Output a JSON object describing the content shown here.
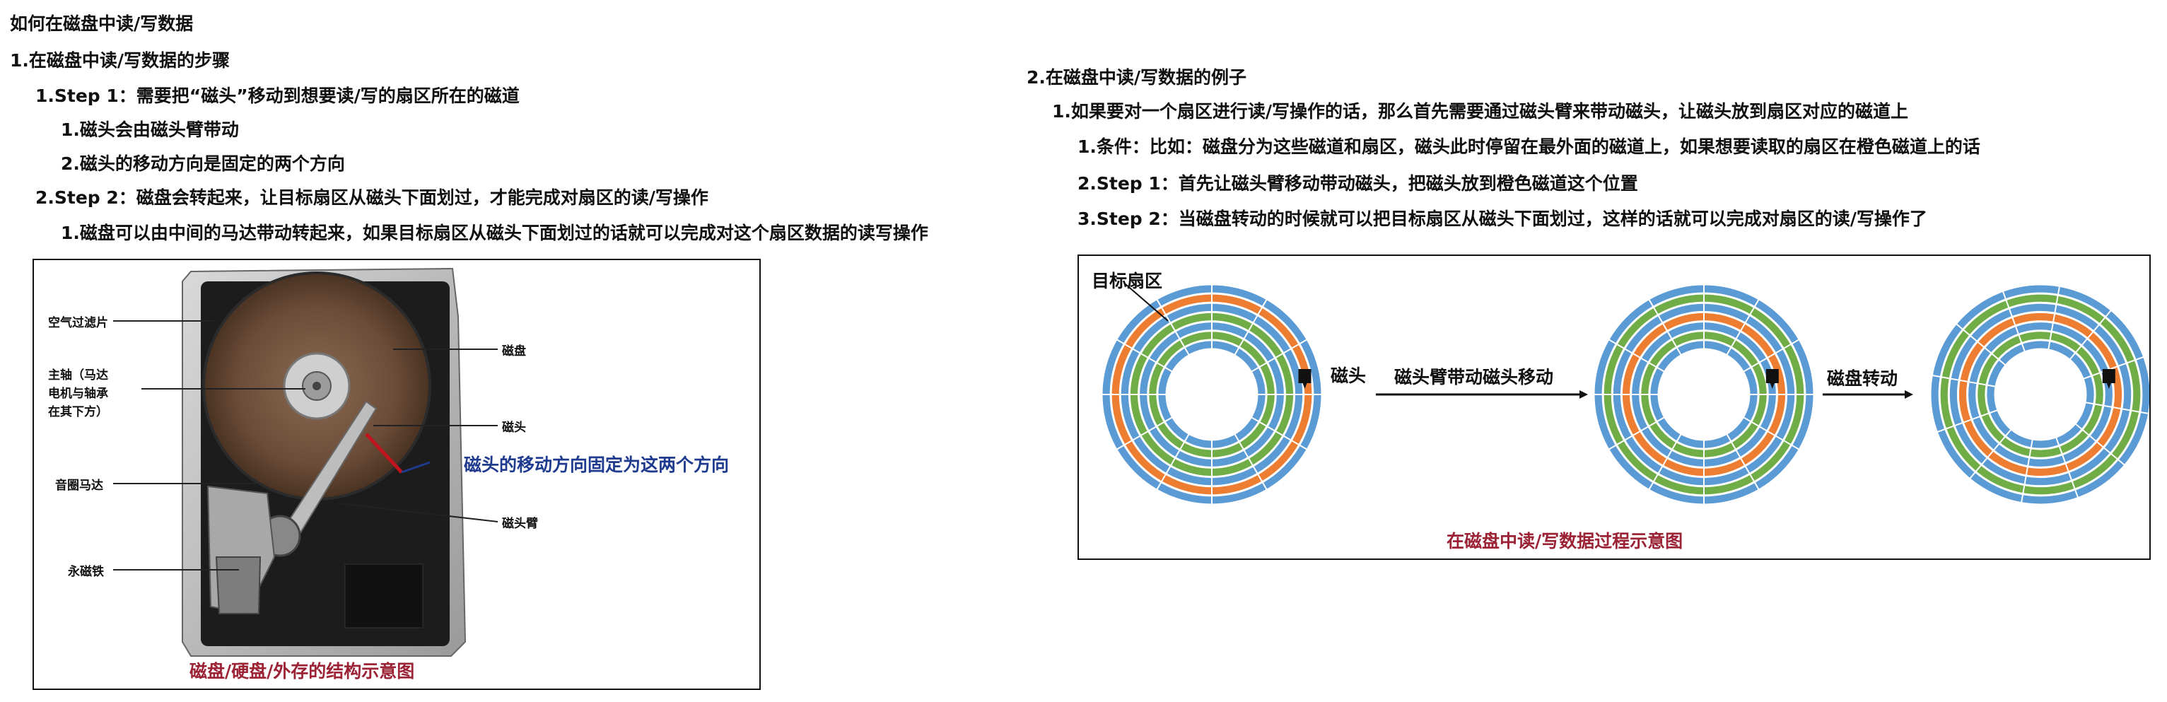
{
  "title": "如何在磁盘中读/写数据",
  "left_outline": {
    "section1": "1.在磁盘中读/写数据的步骤",
    "step1": "1.Step 1：需要把“磁头”移动到想要读/写的扇区所在的磁道",
    "step1_sub1": "1.磁头会由磁头臂带动",
    "step1_sub2": "2.磁头的移动方向是固定的两个方向",
    "step2": "2.Step 2：磁盘会转起来，让目标扇区从磁头下面划过，才能完成对扇区的读/写操作",
    "step2_sub1": "1.磁盘可以由中间的马达带动转起来，如果目标扇区从磁头下面划过的话就可以完成对这个扇区数据的读写操作"
  },
  "hdd_figure": {
    "labels": {
      "air_filter": "空气过滤片",
      "spindle_1": "主轴（马达",
      "spindle_2": "电机与轴承",
      "spindle_3": "在其下方）",
      "voice_coil": "音圈马达",
      "magnet": "永磁铁",
      "platter": "磁盘",
      "head": "磁头",
      "head_arm": "磁头臂"
    },
    "annotation": "磁头的移动方向固定为这两个方向",
    "caption": "磁盘/硬盘/外存的结构示意图"
  },
  "right_outline": {
    "section2": "2.在磁盘中读/写数据的例子",
    "item1": "1.如果要对一个扇区进行读/写操作的话，那么首先需要通过磁头臂来带动磁头，让磁头放到扇区对应的磁道上",
    "sub1": "1.条件：比如：磁盘分为这些磁道和扇区，磁头此时停留在最外面的磁道上，如果想要读取的扇区在橙色磁道上的话",
    "sub2": "2.Step 1：首先让磁头臂移动带动磁头，把磁头放到橙色磁道这个位置",
    "sub3": "3.Step 2：当磁盘转动的时候就可以把目标扇区从磁头下面划过，这样的话就可以完成对扇区的读/写操作了"
  },
  "disk_figure": {
    "target_sector": "目标扇区",
    "head_label": "磁头",
    "arrow1": "磁头臂带动磁头移动",
    "arrow2": "磁盘转动",
    "caption": "在磁盘中读/写数据过程示意图"
  },
  "colors": {
    "track_blue": "#5b9bd5",
    "track_green": "#70ad47",
    "track_orange": "#ed7d31",
    "caption_red": "#9b2335",
    "annotation_blue": "#1f3b8f"
  }
}
